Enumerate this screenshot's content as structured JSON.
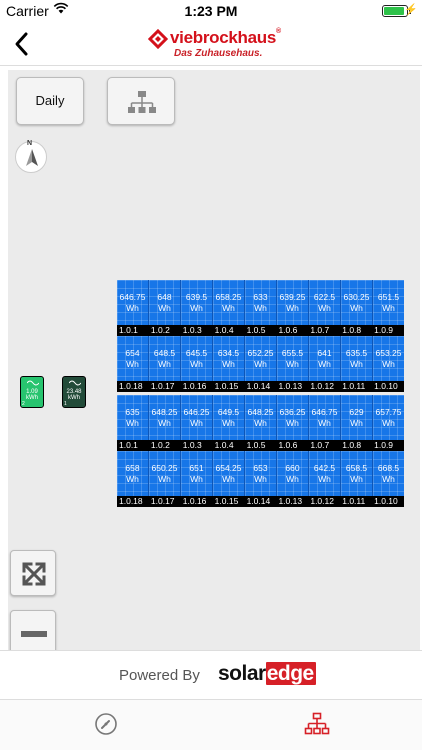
{
  "status_bar": {
    "carrier": "Carrier",
    "time": "1:23 PM",
    "wifi_icon": "wifi-icon",
    "battery_icon": "battery-icon"
  },
  "nav": {
    "back_icon": "chevron-left-icon",
    "brand_name": "viebrockhaus",
    "brand_reg": "®",
    "brand_tagline": "Das Zuhausehaus.",
    "brand_color": "#d4111b"
  },
  "toolbar": {
    "period_label": "Daily",
    "hierarchy_icon": "hierarchy-icon"
  },
  "compass": {
    "north_label": "N"
  },
  "inverters": [
    {
      "value_line1": "1.09",
      "value_line2": "kWh",
      "number": "2",
      "color": "#27c46f"
    },
    {
      "value_line1": "23.48",
      "value_line2": "kWh",
      "number": "1",
      "color": "#224b39"
    }
  ],
  "panel_blocks": [
    {
      "rows": [
        {
          "panels": [
            {
              "value": "646.75",
              "unit": "Wh"
            },
            {
              "value": "648",
              "unit": "Wh"
            },
            {
              "value": "639.5",
              "unit": "Wh"
            },
            {
              "value": "658.25",
              "unit": "Wh"
            },
            {
              "value": "633",
              "unit": "Wh"
            },
            {
              "value": "639.25",
              "unit": "Wh"
            },
            {
              "value": "622.5",
              "unit": "Wh"
            },
            {
              "value": "630.25",
              "unit": "Wh"
            },
            {
              "value": "651.5",
              "unit": "Wh"
            }
          ],
          "labels": [
            "1.0.1",
            "1.0.2",
            "1.0.3",
            "1.0.4",
            "1.0.5",
            "1.0.6",
            "1.0.7",
            "1.0.8",
            "1.0.9"
          ]
        },
        {
          "panels": [
            {
              "value": "654",
              "unit": "Wh"
            },
            {
              "value": "648.5",
              "unit": "Wh"
            },
            {
              "value": "645.5",
              "unit": "Wh"
            },
            {
              "value": "634.5",
              "unit": "Wh"
            },
            {
              "value": "652.25",
              "unit": "Wh"
            },
            {
              "value": "655.5",
              "unit": "Wh"
            },
            {
              "value": "641",
              "unit": "Wh"
            },
            {
              "value": "635.5",
              "unit": "Wh"
            },
            {
              "value": "653.25",
              "unit": "Wh"
            }
          ],
          "labels": [
            "1.0.18",
            "1.0.17",
            "1.0.16",
            "1.0.15",
            "1.0.14",
            "1.0.13",
            "1.0.12",
            "1.0.11",
            "1.0.10"
          ]
        }
      ]
    },
    {
      "rows": [
        {
          "panels": [
            {
              "value": "635",
              "unit": "Wh"
            },
            {
              "value": "648.25",
              "unit": "Wh"
            },
            {
              "value": "646.25",
              "unit": "Wh"
            },
            {
              "value": "649.5",
              "unit": "Wh"
            },
            {
              "value": "648.25",
              "unit": "Wh"
            },
            {
              "value": "636.25",
              "unit": "Wh"
            },
            {
              "value": "646.75",
              "unit": "Wh"
            },
            {
              "value": "629",
              "unit": "Wh"
            },
            {
              "value": "657.75",
              "unit": "Wh"
            }
          ],
          "labels": [
            "1.0.1",
            "1.0.2",
            "1.0.3",
            "1.0.4",
            "1.0.5",
            "1.0.6",
            "1.0.7",
            "1.0.8",
            "1.0.9"
          ]
        },
        {
          "panels": [
            {
              "value": "658",
              "unit": "Wh"
            },
            {
              "value": "650.25",
              "unit": "Wh"
            },
            {
              "value": "651",
              "unit": "Wh"
            },
            {
              "value": "654.25",
              "unit": "Wh"
            },
            {
              "value": "653",
              "unit": "Wh"
            },
            {
              "value": "660",
              "unit": "Wh"
            },
            {
              "value": "642.5",
              "unit": "Wh"
            },
            {
              "value": "658.5",
              "unit": "Wh"
            },
            {
              "value": "668.5",
              "unit": "Wh"
            }
          ],
          "labels": [
            "1.0.18",
            "1.0.17",
            "1.0.16",
            "1.0.15",
            "1.0.14",
            "1.0.13",
            "1.0.12",
            "1.0.11",
            "1.0.10"
          ]
        }
      ]
    }
  ],
  "zoom_controls": {
    "fit_icon": "expand-icon",
    "zoom_out_icon": "minus-icon"
  },
  "powered_by": {
    "text": "Powered By",
    "brand_part1": "solar",
    "brand_part2": "edge",
    "brand_accent": "#d62027"
  },
  "tabs": [
    {
      "icon": "dashboard-gauge-icon",
      "active": false
    },
    {
      "icon": "site-layout-icon",
      "active": true,
      "active_color": "#d62027"
    }
  ]
}
